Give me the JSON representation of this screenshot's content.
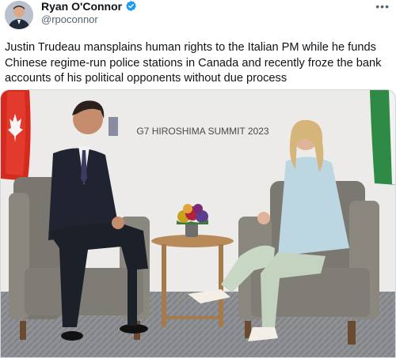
{
  "author": {
    "display_name": "Ryan O'Connor",
    "handle": "@rpoconnor",
    "verified_icon": "verified-badge-icon",
    "verified_color": "#1d9bf0"
  },
  "tweet": {
    "text": "Justin Trudeau mansplains human rights to the Italian PM while he funds Chinese regime-run police stations in Canada and recently froze the bank accounts of his political opponents without due process",
    "more_icon": "more-options-icon"
  },
  "media": {
    "backdrop_text": "G7 HIROSHIMA SUMMIT 2023"
  }
}
